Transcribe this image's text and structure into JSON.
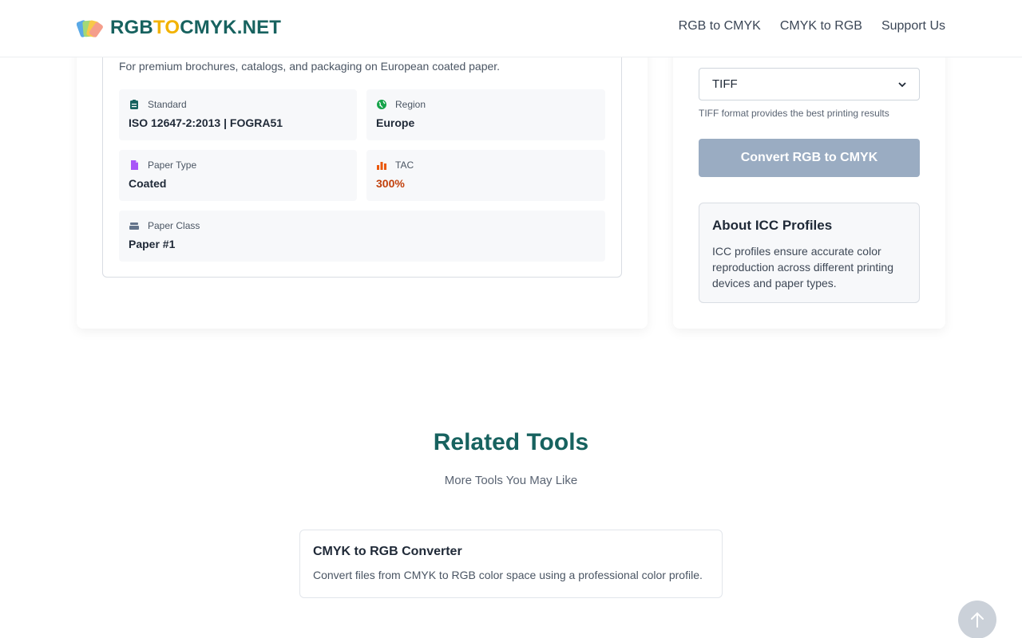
{
  "header": {
    "logo_parts": [
      "RGB",
      "TO",
      "CMYK.NET"
    ],
    "nav": [
      "RGB to CMYK",
      "CMYK to RGB",
      "Support Us"
    ],
    "colors": {
      "logo_primary": "#17625f",
      "logo_accent": "#f2b200"
    }
  },
  "profile": {
    "description": "For premium brochures, catalogs, and packaging on European coated paper.",
    "tiles": [
      {
        "icon": "clipboard-icon",
        "label": "Standard",
        "value": "ISO 12647-2:2013 | FOGRA51"
      },
      {
        "icon": "globe-icon",
        "label": "Region",
        "value": "Europe"
      },
      {
        "icon": "document-icon",
        "label": "Paper Type",
        "value": "Coated"
      },
      {
        "icon": "bar-chart-icon",
        "label": "TAC",
        "value": "300%"
      },
      {
        "icon": "paper-stack-icon",
        "label": "Paper Class",
        "value": "Paper #1"
      }
    ],
    "colors": {
      "tac_value": "#c2410c",
      "standard_icon": "#17625f",
      "region_icon": "#16a34a",
      "paper_type_icon": "#a855f7",
      "tac_icon": "#ea580c",
      "paper_class_icon": "#64748b"
    }
  },
  "converter": {
    "format_selected": "TIFF",
    "format_hint": "TIFF format provides the best printing results",
    "convert_label": "Convert RGB to CMYK",
    "about_title": "About ICC Profiles",
    "about_text": "ICC profiles ensure accurate color reproduction across different printing devices and paper types."
  },
  "related": {
    "title": "Related Tools",
    "subtitle": "More Tools You May Like",
    "tools": [
      {
        "title": "CMYK to RGB Converter",
        "desc": "Convert files from CMYK to RGB color space using a professional color profile."
      }
    ]
  }
}
